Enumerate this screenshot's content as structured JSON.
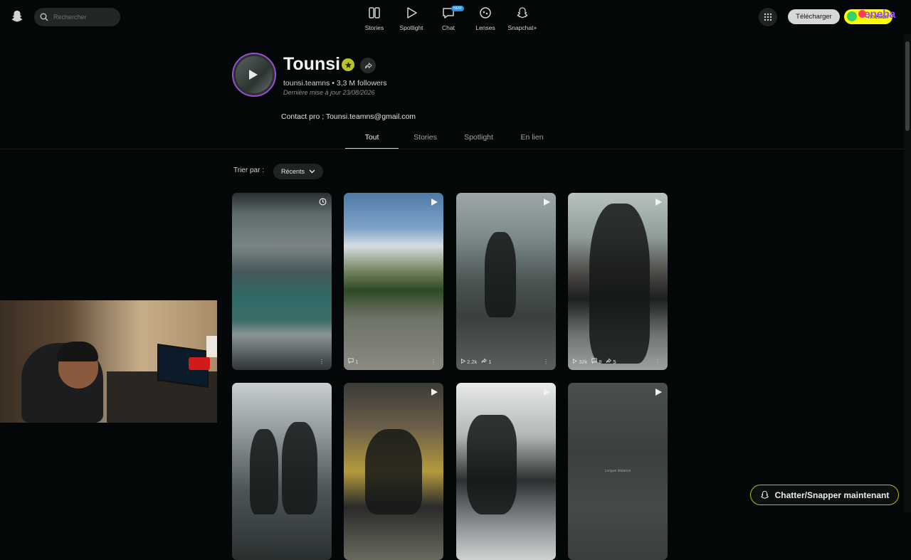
{
  "header": {
    "search_placeholder": "Rechercher",
    "nav": [
      {
        "label": "Stories",
        "icon": "stories-icon"
      },
      {
        "label": "Spotlight",
        "icon": "spotlight-play-icon"
      },
      {
        "label": "Chat",
        "icon": "chat-icon",
        "badge": "NEW"
      },
      {
        "label": "Lenses",
        "icon": "lenses-icon"
      },
      {
        "label": "Snapchat+",
        "icon": "snapchat-plus-icon"
      }
    ],
    "download_label": "Télécharger",
    "login_label": "nnexion",
    "overlay_brand": "eneba"
  },
  "profile": {
    "name": "Tounsi",
    "handle": "tounsi.teamns",
    "separator": "•",
    "followers": "3,3 M followers",
    "updated": "Dernière mise à jour 23/08/2026",
    "contact": "Contact pro ; Tounsi.teamns@gmail.com"
  },
  "tabs": [
    {
      "label": "Tout",
      "active": true
    },
    {
      "label": "Stories",
      "active": false
    },
    {
      "label": "Spotlight",
      "active": false
    },
    {
      "label": "En lien",
      "active": false
    }
  ],
  "sort": {
    "label": "Trier par :",
    "value": "Récents"
  },
  "cards": [
    {
      "comments": "",
      "views": "",
      "shares": "",
      "top_icon": "clock-icon"
    },
    {
      "comments": "1",
      "views": "",
      "shares": "",
      "top_icon": "play-icon"
    },
    {
      "views": "2.2k",
      "shares": "1",
      "comments": "",
      "top_icon": "play-icon"
    },
    {
      "views": "32k",
      "comments": "8",
      "shares": "5",
      "top_icon": "play-icon"
    },
    {
      "top_icon": "play-icon"
    },
    {
      "top_icon": "play-icon"
    },
    {
      "top_icon": "play-icon"
    },
    {
      "top_icon": "play-icon",
      "caption": "Longue distance"
    }
  ],
  "chat_cta": "Chatter/Snapper maintenant",
  "colors": {
    "accent_yellow": "#fffc00",
    "avatar_ring": "#9a4fd1",
    "background": "#040707"
  }
}
